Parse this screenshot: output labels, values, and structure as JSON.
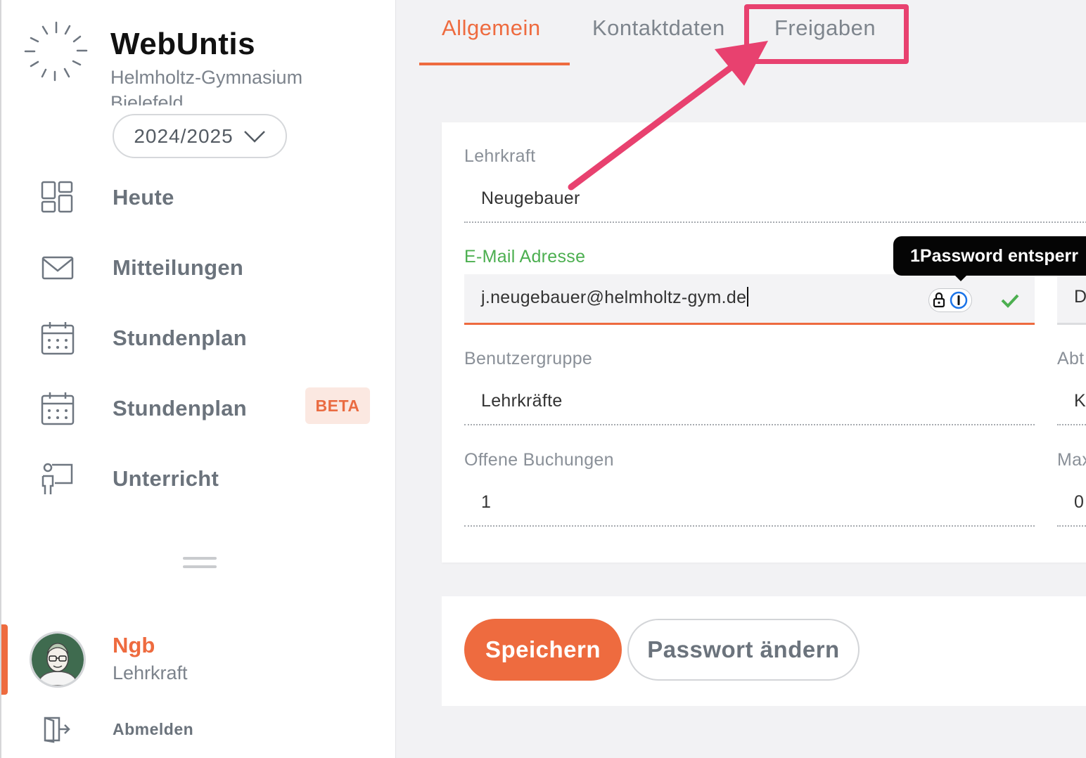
{
  "sidebar": {
    "app_title": "WebUntis",
    "school": "Helmholtz-Gymnasium Bielefeld",
    "school_year": "2024/2025",
    "nav": [
      {
        "label": "Heute",
        "icon": "dashboard-icon"
      },
      {
        "label": "Mitteilungen",
        "icon": "envelope-icon"
      },
      {
        "label": "Stundenplan",
        "icon": "calendar-icon"
      },
      {
        "label": "Stundenplan",
        "icon": "calendar-icon",
        "badge": "BETA"
      },
      {
        "label": "Unterricht",
        "icon": "teacher-board-icon"
      }
    ],
    "user": {
      "name": "Ngb",
      "role": "Lehrkraft"
    },
    "logout_label": "Abmelden"
  },
  "tabs": [
    {
      "label": "Allgemein",
      "active": true
    },
    {
      "label": "Kontaktdaten",
      "active": false
    },
    {
      "label": "Freigaben",
      "active": false
    }
  ],
  "form": {
    "teacher_label": "Lehrkraft",
    "teacher_value": "Neugebauer",
    "email_label": "E-Mail Adresse",
    "email_value": "j.neugebauer@helmholtz-gym.de",
    "email_side_value": "D",
    "group_label": "Benutzergruppe",
    "group_value": "Lehrkräfte",
    "dept_label_partial": "Abt",
    "dept_value_partial": "K",
    "bookings_label": "Offene Buchungen",
    "bookings_value": "1",
    "max_label_partial": "Max",
    "max_value_partial": "0"
  },
  "tooltip": "1Password entsperr",
  "buttons": {
    "save": "Speichern",
    "change_password": "Passwort ändern"
  },
  "colors": {
    "accent": "#ee6b3f",
    "annotation": "#e8416f",
    "valid": "#4caf50"
  }
}
